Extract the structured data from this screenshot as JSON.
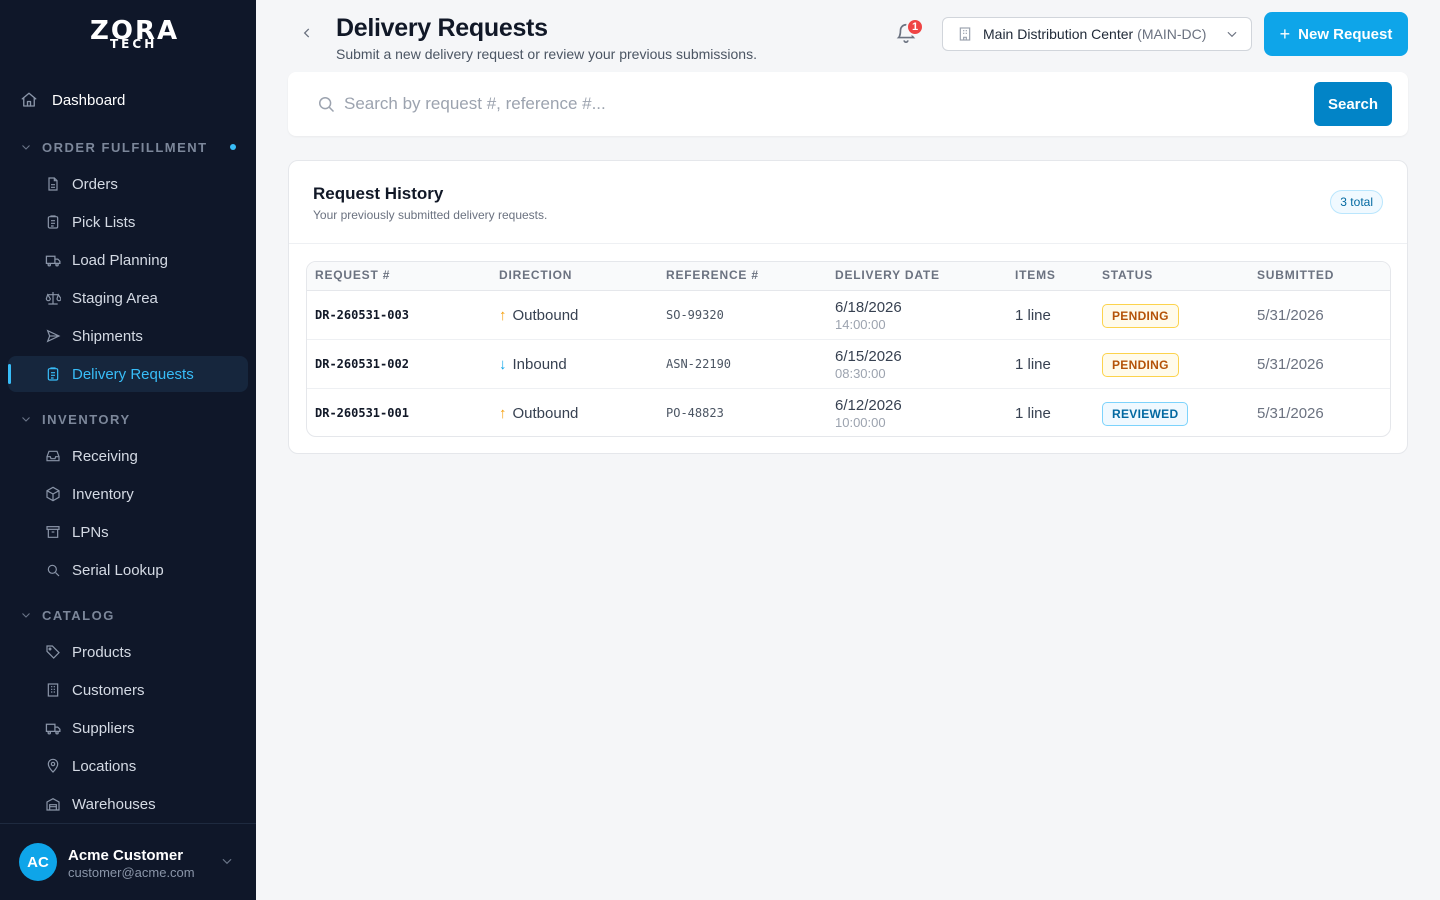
{
  "brand": {
    "line1": "ZORA",
    "line2": "TECH"
  },
  "sidebar": {
    "top_item": {
      "label": "Dashboard",
      "icon": "home-icon"
    },
    "sections": [
      {
        "title": "ORDER FULFILLMENT",
        "items": [
          {
            "label": "Orders",
            "icon": "document-icon"
          },
          {
            "label": "Pick Lists",
            "icon": "clipboard-icon"
          },
          {
            "label": "Load Planning",
            "icon": "truck-icon"
          },
          {
            "label": "Staging Area",
            "icon": "scale-icon"
          },
          {
            "label": "Shipments",
            "icon": "send-icon"
          },
          {
            "label": "Delivery Requests",
            "icon": "clipboard-list-icon",
            "active": true
          }
        ]
      },
      {
        "title": "INVENTORY",
        "items": [
          {
            "label": "Receiving",
            "icon": "inbox-icon"
          },
          {
            "label": "Inventory",
            "icon": "box-icon"
          },
          {
            "label": "LPNs",
            "icon": "archive-icon"
          },
          {
            "label": "Serial Lookup",
            "icon": "search-icon"
          }
        ]
      },
      {
        "title": "CATALOG",
        "items": [
          {
            "label": "Products",
            "icon": "tag-icon"
          },
          {
            "label": "Customers",
            "icon": "building-icon"
          },
          {
            "label": "Suppliers",
            "icon": "truck-icon"
          },
          {
            "label": "Locations",
            "icon": "map-pin-icon"
          },
          {
            "label": "Warehouses",
            "icon": "warehouse-icon"
          }
        ]
      }
    ]
  },
  "user": {
    "initials": "AC",
    "name": "Acme Customer",
    "email": "customer@acme.com"
  },
  "header": {
    "title": "Delivery Requests",
    "subtitle": "Submit a new delivery request or review your previous submissions.",
    "notification_count": "1",
    "warehouse": {
      "name": "Main Distribution Center",
      "code": "(MAIN-DC)"
    },
    "new_request_label": "New Request"
  },
  "search": {
    "placeholder": "Search by request #, reference #...",
    "value": "",
    "button_label": "Search"
  },
  "history": {
    "title": "Request History",
    "subtitle": "Your previously submitted delivery requests.",
    "total_label": "3 total",
    "columns": [
      "REQUEST #",
      "DIRECTION",
      "REFERENCE #",
      "DELIVERY DATE",
      "ITEMS",
      "STATUS",
      "SUBMITTED"
    ],
    "rows": [
      {
        "request": "DR-260531-003",
        "direction": "Outbound",
        "direction_icon": "arrow-up-icon",
        "reference": "SO-99320",
        "delivery_date": "6/18/2026",
        "delivery_time": "14:00:00",
        "items": "1 line",
        "status": "PENDING",
        "submitted": "5/31/2026"
      },
      {
        "request": "DR-260531-002",
        "direction": "Inbound",
        "direction_icon": "arrow-down-icon",
        "reference": "ASN-22190",
        "delivery_date": "6/15/2026",
        "delivery_time": "08:30:00",
        "items": "1 line",
        "status": "PENDING",
        "submitted": "5/31/2026"
      },
      {
        "request": "DR-260531-001",
        "direction": "Outbound",
        "direction_icon": "arrow-up-icon",
        "reference": "PO-48823",
        "delivery_date": "6/12/2026",
        "delivery_time": "10:00:00",
        "items": "1 line",
        "status": "REVIEWED",
        "submitted": "5/31/2026"
      }
    ]
  },
  "colors": {
    "accent": "#0ea5e9",
    "sidebar_bg": "#0f1729",
    "outbound_arrow": "#f59e0b",
    "inbound_arrow": "#0ea5e9",
    "pending": "#b45309",
    "reviewed": "#0369a1"
  }
}
